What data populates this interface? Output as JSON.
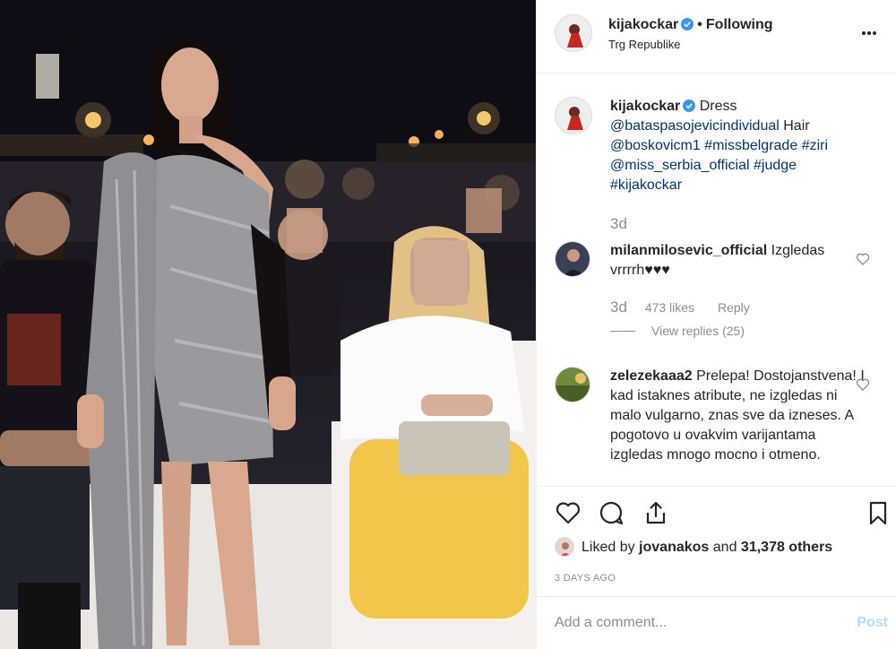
{
  "post": {
    "username": "kijakockar",
    "follow_status": "Following",
    "location": "Trg Republike"
  },
  "caption": {
    "username": "kijakockar",
    "text_before": "Dress",
    "mention_1": "@bataspasojevicindividual",
    "text_middle": "Hair",
    "mention_2": "@boskovicm1",
    "tag_1": "#missbelgrade",
    "tag_2": "#ziri",
    "mention_3": "@miss_serbia_official",
    "tag_3": "#judge",
    "tag_4": "#kijakockar",
    "time": "3d"
  },
  "comments": [
    {
      "username": "milanmilosevic_official",
      "text": "Izgledas vrrrrh♥♥♥",
      "time": "3d",
      "likes": "473 likes",
      "reply_label": "Reply",
      "view_replies": "View replies (25)"
    },
    {
      "username": "zelezekaaa2",
      "text": "Prelepa! Dostojanstvena! I kad istaknes atribute, ne izgledas ni malo vulgarno, znas sve da izneses. A pogotovo u ovakvim varijantama izgledas mnogo mocno i otmeno."
    }
  ],
  "footer": {
    "liked_by_prefix": "Liked by",
    "liked_by_user": "jovanakos",
    "liked_by_suffix_and": "and",
    "liked_by_others": "31,378 others",
    "posted_ago": "3 DAYS AGO",
    "comment_placeholder": "Add a comment...",
    "post_label": "Post"
  },
  "icons": {
    "verified": "verified-badge-icon",
    "more": "more-options-icon",
    "like": "heart-icon",
    "comment": "comment-bubble-icon",
    "share": "share-icon",
    "save": "bookmark-icon"
  },
  "colors": {
    "link": "#00376b",
    "verified": "#3897f0",
    "secondary_text": "#8e8e8e",
    "post_button_disabled": "#b3dbff"
  }
}
